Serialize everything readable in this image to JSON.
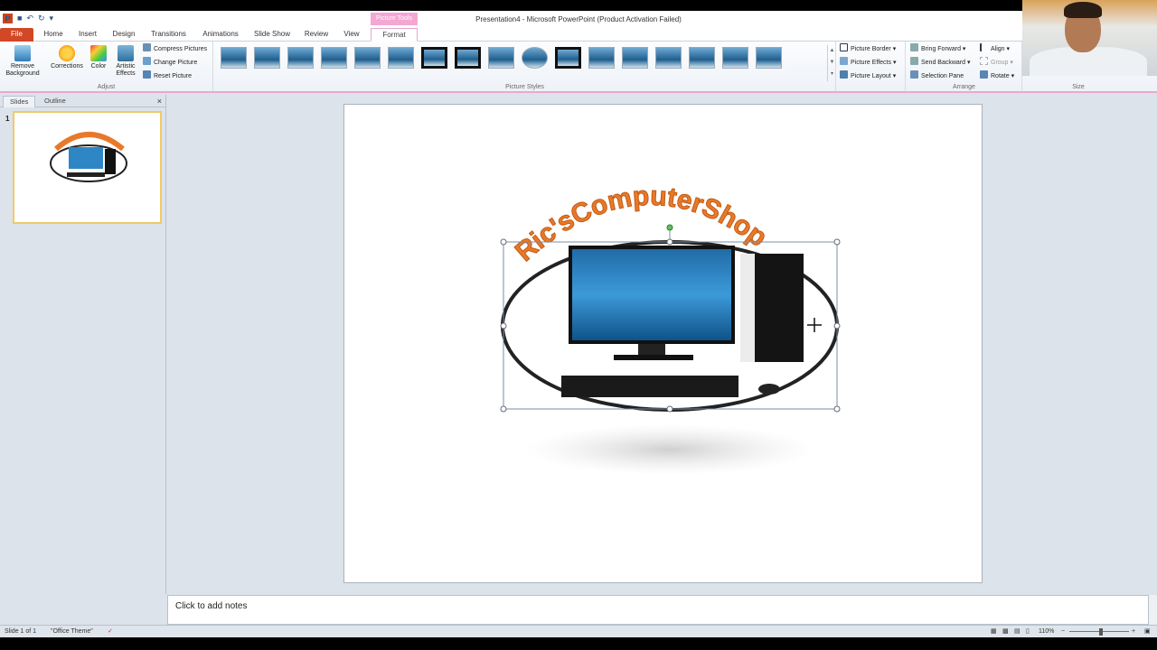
{
  "window": {
    "title": "Presentation4  -  Microsoft PowerPoint (Product Activation Failed)",
    "context_tab": "Picture Tools"
  },
  "tabs": [
    {
      "label": "File"
    },
    {
      "label": "Home"
    },
    {
      "label": "Insert"
    },
    {
      "label": "Design"
    },
    {
      "label": "Transitions"
    },
    {
      "label": "Animations"
    },
    {
      "label": "Slide Show"
    },
    {
      "label": "Review"
    },
    {
      "label": "View"
    },
    {
      "label": "Format"
    }
  ],
  "ribbon": {
    "adjust": {
      "remove_background": "Remove Background",
      "corrections": "Corrections",
      "color": "Color",
      "artistic_effects": "Artistic Effects",
      "compress": "Compress Pictures",
      "change": "Change Picture",
      "reset": "Reset Picture",
      "group_label": "Adjust"
    },
    "picture_styles": {
      "group_label": "Picture Styles"
    },
    "picture_options": {
      "border": "Picture Border",
      "effects": "Picture Effects",
      "layout": "Picture Layout"
    },
    "arrange": {
      "bring_forward": "Bring Forward",
      "send_backward": "Send Backward",
      "selection_pane": "Selection Pane",
      "align": "Align",
      "group": "Group",
      "rotate": "Rotate",
      "group_label": "Arrange"
    },
    "size": {
      "group_label": "Size"
    }
  },
  "slides_pane": {
    "tab_slides": "Slides",
    "tab_outline": "Outline",
    "close": "×",
    "slide_number": "1"
  },
  "slide": {
    "logo_text": "Ric'sComputerShop"
  },
  "notes": {
    "placeholder": "Click to add notes"
  },
  "status": {
    "slide_info": "Slide 1 of 1",
    "theme": "\"Office Theme\"",
    "zoom": "110%"
  },
  "colors": {
    "file_tab": "#d24726",
    "context_tab": "#f4a7d4",
    "logo_orange": "#e8792b"
  }
}
